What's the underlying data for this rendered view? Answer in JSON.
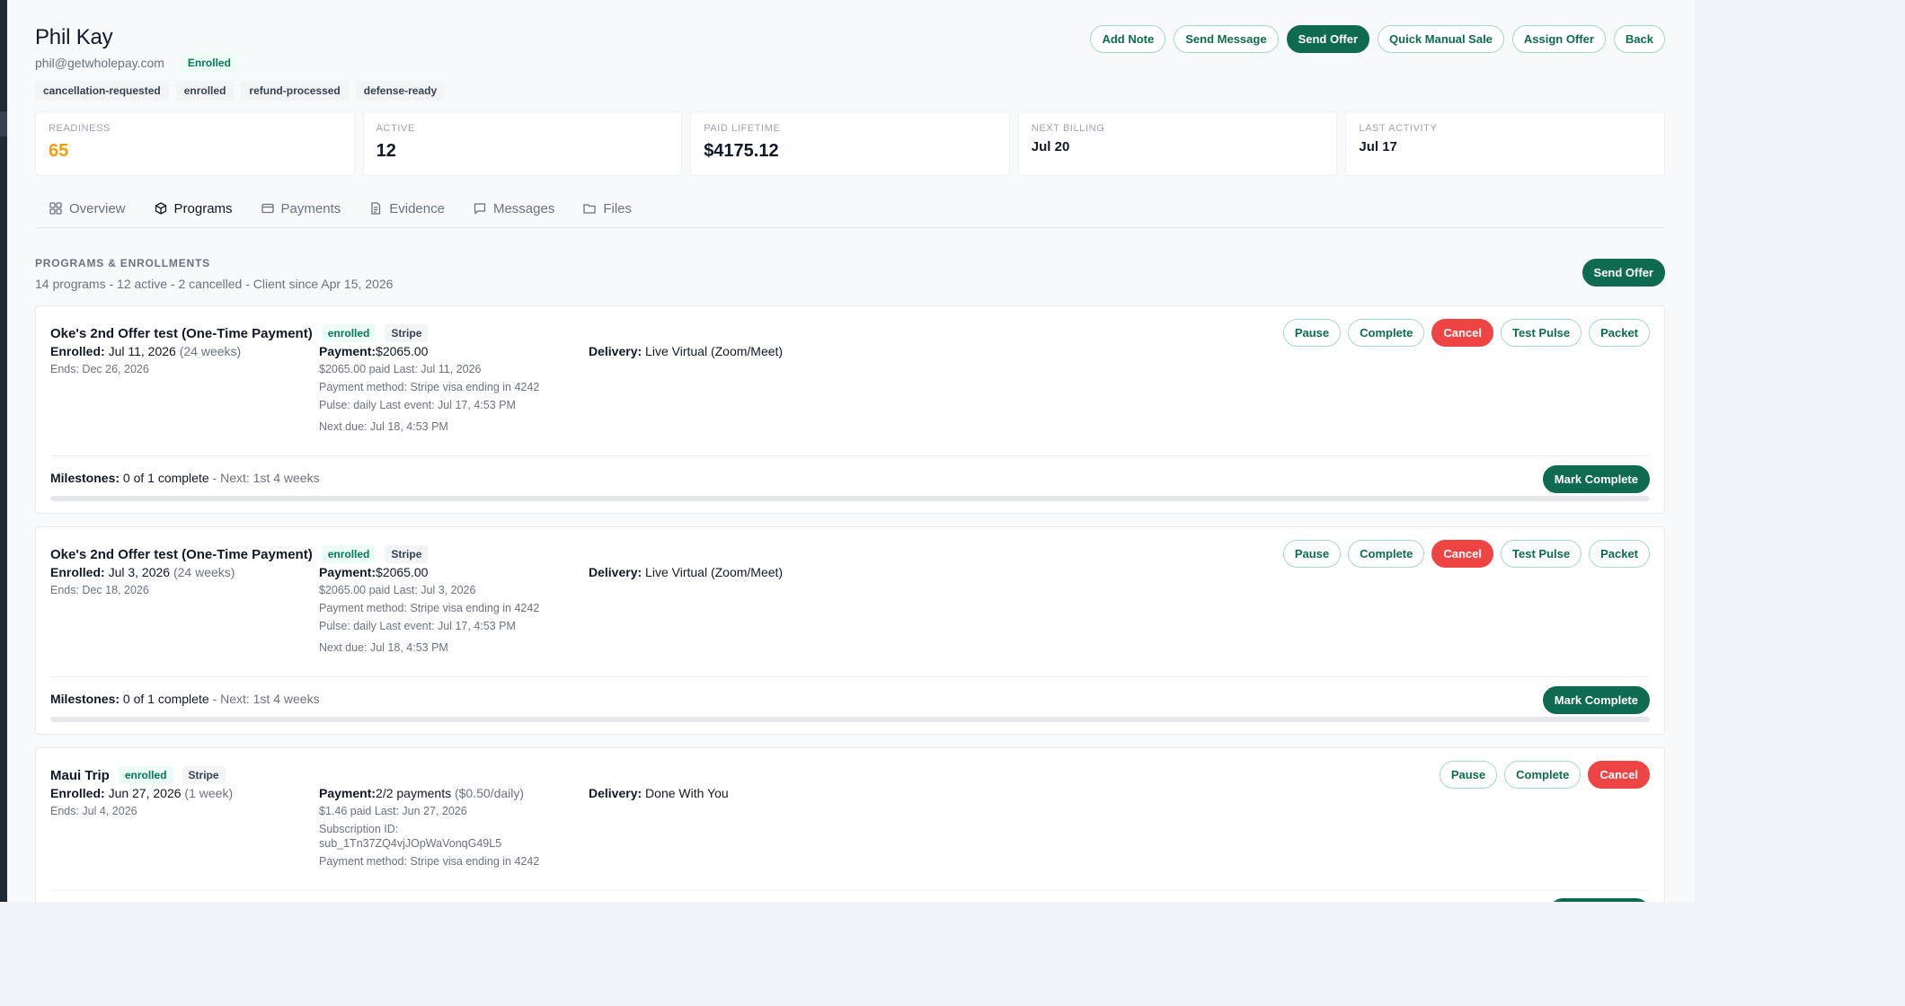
{
  "client": {
    "name": "Phil Kay",
    "email": "phil@getwholepay.com",
    "status": "Enrolled",
    "tags": [
      "cancellation-requested",
      "enrolled",
      "refund-processed",
      "defense-ready"
    ]
  },
  "header_actions": {
    "add_note": "Add Note",
    "send_message": "Send Message",
    "send_offer": "Send Offer",
    "quick_manual_sale": "Quick Manual Sale",
    "assign_offer": "Assign Offer",
    "back": "Back"
  },
  "stats": [
    {
      "label": "Readiness",
      "value": "65"
    },
    {
      "label": "Active",
      "value": "12"
    },
    {
      "label": "Paid Lifetime",
      "value": "$4175.12"
    },
    {
      "label": "Next Billing",
      "value": "Jul 20"
    },
    {
      "label": "Last Activity",
      "value": "Jul 17"
    }
  ],
  "tabs": [
    {
      "label": "Overview",
      "icon": "grid-icon"
    },
    {
      "label": "Programs",
      "icon": "cube-icon"
    },
    {
      "label": "Payments",
      "icon": "credit-card-icon"
    },
    {
      "label": "Evidence",
      "icon": "document-icon"
    },
    {
      "label": "Messages",
      "icon": "chat-icon"
    },
    {
      "label": "Files",
      "icon": "folder-icon"
    }
  ],
  "active_tab": "Programs",
  "section": {
    "title": "PROGRAMS & ENROLLMENTS",
    "subtitle": "14 programs - 12 active - 2 cancelled - Client since Apr 15, 2026",
    "send_offer": "Send Offer"
  },
  "colors": {
    "primary": "#0f6b4f",
    "danger": "#ef4444",
    "readiness": "#f59e0b"
  },
  "programs": [
    {
      "name": "Oke's 2nd Offer test (One-Time Payment)",
      "status": "enrolled",
      "processor": "Stripe",
      "actions": {
        "pause": "Pause",
        "complete": "Complete",
        "cancel": "Cancel",
        "test_pulse": "Test Pulse",
        "packet": "Packet"
      },
      "enrolled_label": "Enrolled:",
      "enrolled_date": "Jul 11, 2026",
      "duration": "(24 weeks)",
      "ends": "Ends: Dec 26, 2026",
      "payment_label": "Payment:",
      "payment_value": "$2065.00",
      "payment_detail": "",
      "paid_line": "$2065.00 paid  Last: Jul 11, 2026",
      "method_line": "Payment method: Stripe visa ending in 4242",
      "pulse_line": "Pulse: daily  Last event: Jul 17, 4:53 PM",
      "next_due": "Next due: Jul 18, 4:53 PM",
      "delivery_label": "Delivery:",
      "delivery_value": "Live Virtual (Zoom/Meet)",
      "milestones_label": "Milestones:",
      "milestones_value": "0 of 1 complete",
      "milestones_next": "- Next: 1st 4 weeks",
      "mark_complete": "Mark Complete",
      "progress": 0
    },
    {
      "name": "Oke's 2nd Offer test (One-Time Payment)",
      "status": "enrolled",
      "processor": "Stripe",
      "actions": {
        "pause": "Pause",
        "complete": "Complete",
        "cancel": "Cancel",
        "test_pulse": "Test Pulse",
        "packet": "Packet"
      },
      "enrolled_label": "Enrolled:",
      "enrolled_date": "Jul 3, 2026",
      "duration": "(24 weeks)",
      "ends": "Ends: Dec 18, 2026",
      "payment_label": "Payment:",
      "payment_value": "$2065.00",
      "payment_detail": "",
      "paid_line": "$2065.00 paid  Last: Jul 3, 2026",
      "method_line": "Payment method: Stripe visa ending in 4242",
      "pulse_line": "Pulse: daily  Last event: Jul 17, 4:53 PM",
      "next_due": "Next due: Jul 18, 4:53 PM",
      "delivery_label": "Delivery:",
      "delivery_value": "Live Virtual (Zoom/Meet)",
      "milestones_label": "Milestones:",
      "milestones_value": "0 of 1 complete",
      "milestones_next": "- Next: 1st 4 weeks",
      "mark_complete": "Mark Complete",
      "progress": 0
    },
    {
      "name": "Maui Trip",
      "status": "enrolled",
      "processor": "Stripe",
      "actions": {
        "pause": "Pause",
        "complete": "Complete",
        "cancel": "Cancel"
      },
      "enrolled_label": "Enrolled:",
      "enrolled_date": "Jun 27, 2026",
      "duration": "(1 week)",
      "ends": "Ends: Jul 4, 2026",
      "payment_label": "Payment:",
      "payment_value": "2/2 payments",
      "payment_detail": "($0.50/daily)",
      "paid_line": "$1.46 paid  Last: Jun 27, 2026",
      "subscription_label": "Subscription ID:",
      "subscription_id": "sub_1Tn37ZQ4vjJOpWaVonqG49L5",
      "method_line": "Payment method: Stripe visa ending in 4242",
      "delivery_label": "Delivery:",
      "delivery_value": "Done With You"
    }
  ]
}
